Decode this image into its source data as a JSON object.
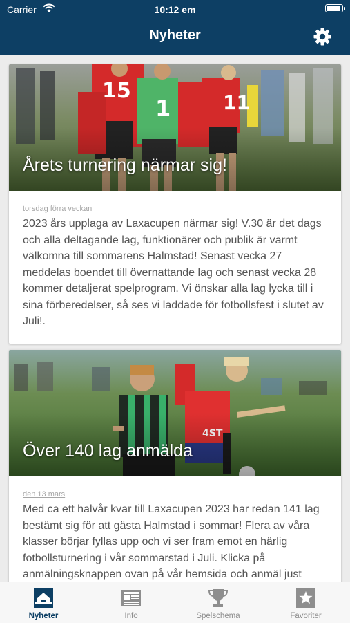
{
  "status": {
    "carrier": "Carrier",
    "time": "10:12 em",
    "battery_level": 0.95
  },
  "nav": {
    "title": "Nyheter"
  },
  "colors": {
    "brand": "#0d3f64",
    "tab_inactive": "#8e8e8e",
    "background": "#ececec"
  },
  "news": [
    {
      "title": "Årets turnering närmar sig!",
      "date": "torsdag förra veckan",
      "text": "2023 års upplaga av Laxacupen närmar sig! V.30 är det dags och alla deltagande lag, funktionärer och publik är varmt välkomna till sommarens Halmstad! Senast vecka 27 meddelas boendet till övernattande lag och senast vecka 28 kommer detaljerat spelprogram. Vi önskar alla lag lycka till i sina förberedelser, så ses vi laddade för fotbollsfest i slutet av Juli!."
    },
    {
      "title": "Över 140 lag anmälda",
      "date": "den 13 mars",
      "text": "Med ca ett halvår kvar till Laxacupen 2023 har redan 141 lag bestämt sig för att gästa Halmstad i sommar! Flera av våra klasser börjar fyllas upp och vi ser fram emot en härlig fotbollsturnering i vår sommarstad i Juli. Klicka på anmälningsknappen ovan på vår hemsida och anmäl just"
    }
  ],
  "tabs": [
    {
      "label": "Nyheter",
      "icon": "home-icon"
    },
    {
      "label": "Info",
      "icon": "newspaper-icon"
    },
    {
      "label": "Spelschema",
      "icon": "trophy-icon"
    },
    {
      "label": "Favoriter",
      "icon": "star-icon"
    }
  ]
}
